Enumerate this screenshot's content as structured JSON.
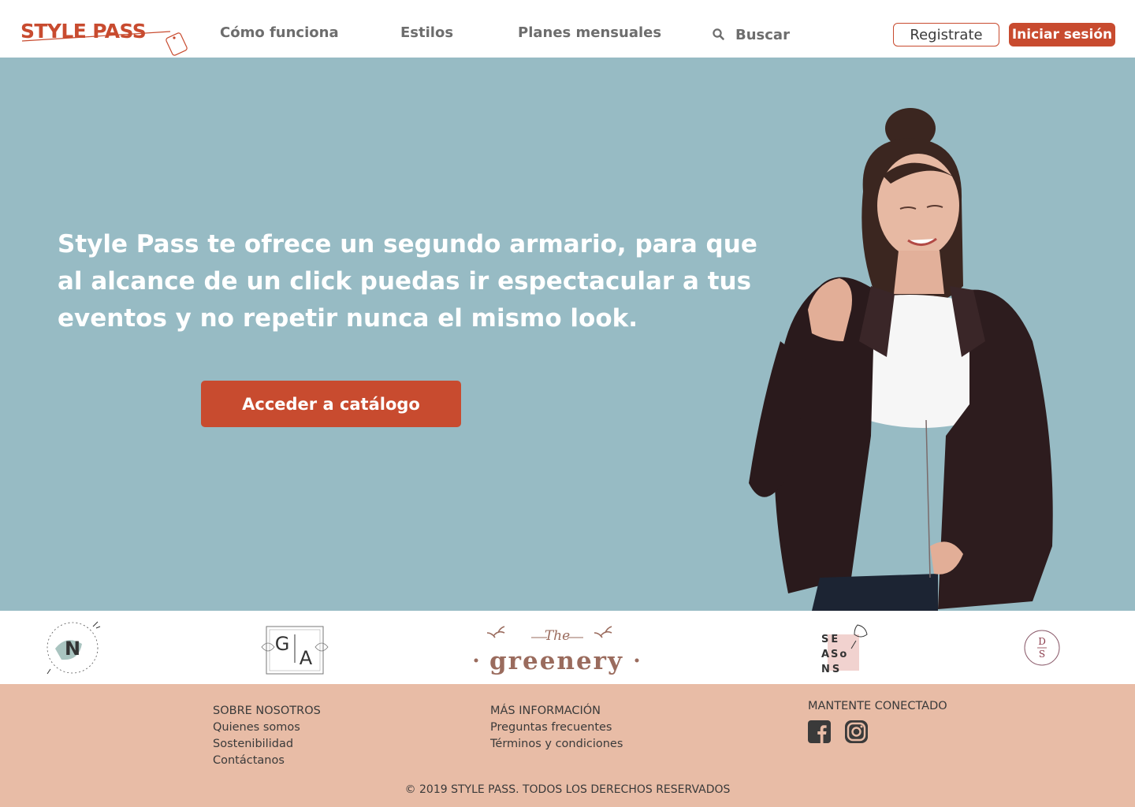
{
  "header": {
    "logo_text": "STYLE PASS",
    "nav": [
      "Cómo funciona",
      "Estilos",
      "Planes mensuales"
    ],
    "search_label": "Buscar",
    "register_label": "Registrate",
    "login_label": "Iniciar sesión"
  },
  "hero": {
    "headline": "Style Pass te ofrece un segundo armario, para que al alcance de un click puedas ir espectacular a tus eventos y no repetir nunca el mismo look.",
    "cta_label": "Acceder a catálogo"
  },
  "brands": {
    "n_letter": "N",
    "ga_g": "G",
    "ga_a": "A",
    "greenery_small": "The",
    "greenery_big": "greenery",
    "seasons_lines": [
      "SE",
      "ASo",
      "NS"
    ],
    "ds_letters": [
      "D",
      "S"
    ]
  },
  "footer": {
    "col1": {
      "heading": "SOBRE NOSOTROS",
      "links": [
        "Quienes somos",
        "Sostenibilidad",
        "Contáctanos"
      ]
    },
    "col2": {
      "heading": "MÁS INFORMACIÓN",
      "links": [
        "Preguntas frecuentes",
        "Términos y condiciones"
      ]
    },
    "social": {
      "heading": "MANTENTE CONECTADO",
      "icons": [
        "facebook-icon",
        "instagram-icon"
      ]
    },
    "copyright": "© 2019 STYLE PASS. TODOS LOS DERECHOS RESERVADOS"
  },
  "colors": {
    "brand": "#c84b2f",
    "hero_bg": "#97bbc4",
    "footer_bg": "#e8bca6",
    "nav_text": "#6d6d6d"
  }
}
